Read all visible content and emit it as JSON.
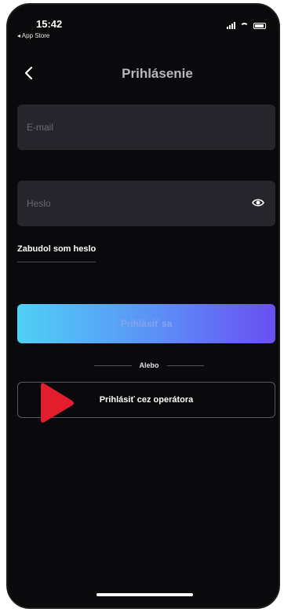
{
  "status_bar": {
    "time": "15:42",
    "back_app": "◂ App Store"
  },
  "nav": {
    "title": "Prihlásenie",
    "back_icon": "chevron-left-icon"
  },
  "form": {
    "email_placeholder": "E-mail",
    "email_value": "",
    "password_placeholder": "Heslo",
    "password_value": "",
    "eye_icon": "eye-icon",
    "forgot_label": "Zabudol som heslo",
    "login_label": "Prihlásiť sa",
    "divider_label": "Alebo",
    "operator_label": "Prihlásiť cez operátora"
  },
  "colors": {
    "background": "#0a0a0c",
    "field": "#26252c",
    "gradient_start": "#4fd1f5",
    "gradient_end": "#6a4ff2",
    "arrow": "#e11d2e"
  }
}
